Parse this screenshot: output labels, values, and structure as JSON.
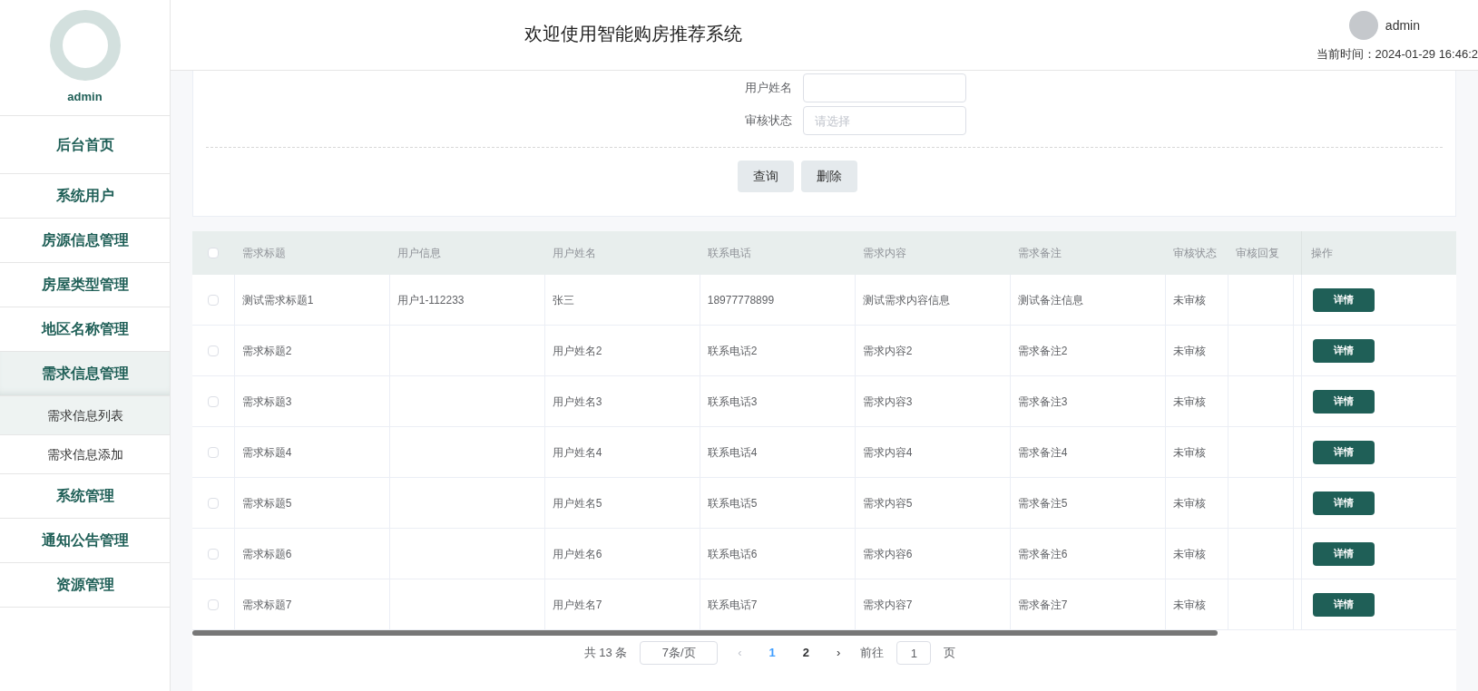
{
  "sidebar": {
    "user": "admin",
    "items": [
      {
        "label": "后台首页"
      },
      {
        "label": "系统用户"
      },
      {
        "label": "房源信息管理"
      },
      {
        "label": "房屋类型管理"
      },
      {
        "label": "地区名称管理"
      },
      {
        "label": "需求信息管理",
        "expanded": true,
        "children": [
          {
            "label": "需求信息列表",
            "selected": true
          },
          {
            "label": "需求信息添加",
            "selected": false
          }
        ]
      },
      {
        "label": "系统管理"
      },
      {
        "label": "通知公告管理"
      },
      {
        "label": "资源管理"
      }
    ]
  },
  "header": {
    "title": "欢迎使用智能购房推荐系统",
    "user": "admin",
    "time": "当前时间：2024-01-29 16:46:2"
  },
  "search": {
    "fields": [
      {
        "label": "用户姓名"
      },
      {
        "label": "审核状态",
        "placeholder": "请选择"
      }
    ],
    "buttons": [
      "查询",
      "删除"
    ]
  },
  "table": {
    "all_checked": false,
    "columns": [
      "需求标题",
      "用户信息",
      "用户姓名",
      "联系电话",
      "需求内容",
      "需求备注",
      "审核状态",
      "审核回复",
      "操作"
    ],
    "rows": [
      {
        "checked": false,
        "cells": [
          "测试需求标题1",
          "用户1-112233",
          "张三",
          "18977778899",
          "测试需求内容信息",
          "测试备注信息",
          "未审核",
          ""
        ],
        "action": "详情"
      },
      {
        "checked": false,
        "cells": [
          "需求标题2",
          "",
          "用户姓名2",
          "联系电话2",
          "需求内容2",
          "需求备注2",
          "未审核",
          ""
        ],
        "action": "详情"
      },
      {
        "checked": false,
        "cells": [
          "需求标题3",
          "",
          "用户姓名3",
          "联系电话3",
          "需求内容3",
          "需求备注3",
          "未审核",
          ""
        ],
        "action": "详情"
      },
      {
        "checked": false,
        "cells": [
          "需求标题4",
          "",
          "用户姓名4",
          "联系电话4",
          "需求内容4",
          "需求备注4",
          "未审核",
          ""
        ],
        "action": "详情"
      },
      {
        "checked": false,
        "cells": [
          "需求标题5",
          "",
          "用户姓名5",
          "联系电话5",
          "需求内容5",
          "需求备注5",
          "未审核",
          ""
        ],
        "action": "详情"
      },
      {
        "checked": false,
        "cells": [
          "需求标题6",
          "",
          "用户姓名6",
          "联系电话6",
          "需求内容6",
          "需求备注6",
          "未审核",
          ""
        ],
        "action": "详情"
      },
      {
        "checked": false,
        "cells": [
          "需求标题7",
          "",
          "用户姓名7",
          "联系电话7",
          "需求内容7",
          "需求备注7",
          "未审核",
          ""
        ],
        "action": "详情"
      }
    ]
  },
  "pagination": {
    "total": "共 13 条",
    "page_size": "7条/页",
    "prev": "‹",
    "pages": [
      {
        "label": "1",
        "selected": true
      },
      {
        "label": "2",
        "selected": false
      }
    ],
    "next": "›",
    "goto": "前往",
    "goto_value": "1",
    "page_unit": "页"
  }
}
